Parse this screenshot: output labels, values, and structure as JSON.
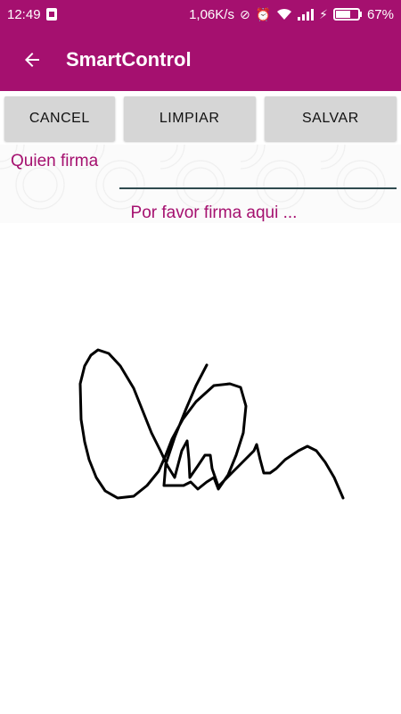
{
  "status_bar": {
    "time": "12:49",
    "network_speed": "1,06K/s",
    "battery_percent": "67%",
    "battery_level": 0.67
  },
  "app_bar": {
    "title": "SmartControl",
    "back_icon": "arrow-back-icon"
  },
  "actions": {
    "cancel_label": "CANCEL",
    "clear_label": "LIMPIAR",
    "save_label": "SALVAR"
  },
  "form": {
    "signer_label": "Quien firma",
    "signer_value": ""
  },
  "signature": {
    "prompt": "Por favor firma aqui ..."
  },
  "colors": {
    "accent": "#a5106f",
    "button_bg": "#d6d6d6"
  }
}
